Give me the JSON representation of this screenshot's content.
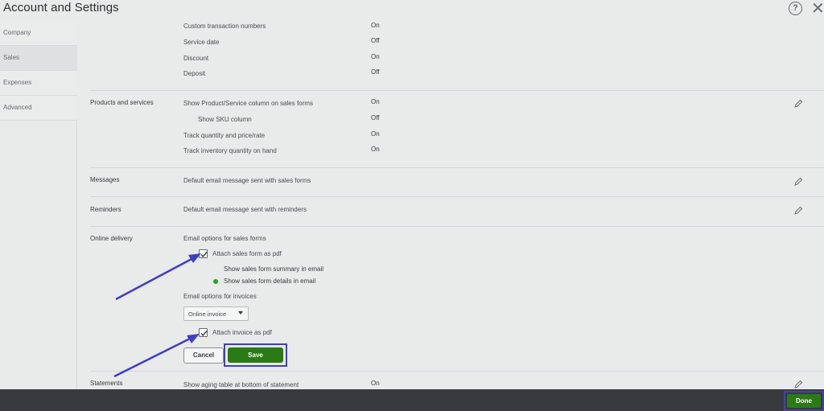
{
  "header": {
    "title": "Account and Settings",
    "help_icon": "?",
    "close_icon": "✕"
  },
  "sidebar": {
    "items": [
      {
        "label": "Company"
      },
      {
        "label": "Sales"
      },
      {
        "label": "Expenses"
      },
      {
        "label": "Advanced"
      }
    ]
  },
  "sales_form_content": {
    "rows": [
      {
        "label": "Custom transaction numbers",
        "value": "On"
      },
      {
        "label": "Service date",
        "value": "Off"
      },
      {
        "label": "Discount",
        "value": "On"
      },
      {
        "label": "Deposit",
        "value": "Off"
      }
    ]
  },
  "products_services": {
    "title": "Products and services",
    "rows": [
      {
        "label": "Show Product/Service column on sales forms",
        "value": "On"
      },
      {
        "label": "Show SKU column",
        "value": "Off"
      },
      {
        "label": "Track quantity and price/rate",
        "value": "On"
      },
      {
        "label": "Track inventory quantity on hand",
        "value": "On"
      }
    ]
  },
  "messages": {
    "title": "Messages",
    "text": "Default email message sent with sales forms"
  },
  "reminders": {
    "title": "Reminders",
    "text": "Default email message sent with reminders"
  },
  "online_delivery": {
    "title": "Online delivery",
    "email_options_sales": "Email options for sales forms",
    "attach_sales_pdf": "Attach sales form as pdf",
    "summary_option": "Show sales form summary in email",
    "details_option": "Show sales form details in email",
    "email_options_invoices": "Email options for invoices",
    "invoice_dropdown": "Online invoice",
    "attach_invoice_pdf": "Attach invoice as pdf",
    "cancel_label": "Cancel",
    "save_label": "Save"
  },
  "statements": {
    "title": "Statements",
    "text": "Show aging table at bottom of statement",
    "value": "On"
  },
  "footer": {
    "done_label": "Done"
  },
  "colors": {
    "accent_green": "#2a7a16",
    "annotation_blue": "#3f3fc2",
    "radio_green": "#2ca01c"
  }
}
